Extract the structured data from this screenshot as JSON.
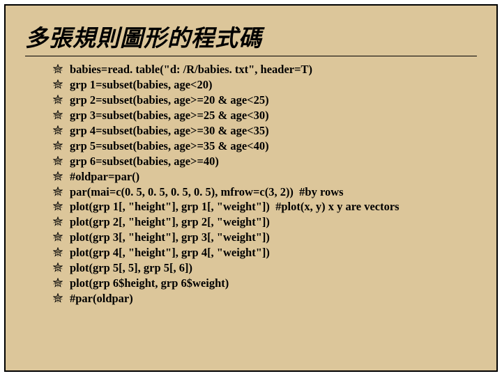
{
  "title": "多張規則圖形的程式碼",
  "bullets": [
    "babies=read. table(\"d: /R/babies. txt\", header=T)",
    "grp 1=subset(babies, age<20)",
    "grp 2=subset(babies, age>=20 & age<25)",
    "grp 3=subset(babies, age>=25 & age<30)",
    "grp 4=subset(babies, age>=30 & age<35)",
    "grp 5=subset(babies, age>=35 & age<40)",
    "grp 6=subset(babies, age>=40)",
    "#oldpar=par()",
    "par(mai=c(0. 5, 0. 5, 0. 5, 0. 5), mfrow=c(3, 2))  #by rows",
    "plot(grp 1[, \"height\"], grp 1[, \"weight\"])  #plot(x, y) x y are vectors",
    "plot(grp 2[, \"height\"], grp 2[, \"weight\"])",
    "plot(grp 3[, \"height\"], grp 3[, \"weight\"])",
    "plot(grp 4[, \"height\"], grp 4[, \"weight\"])",
    "plot(grp 5[, 5], grp 5[, 6])",
    "plot(grp 6$height, grp 6$weight)",
    "#par(oldpar)"
  ]
}
